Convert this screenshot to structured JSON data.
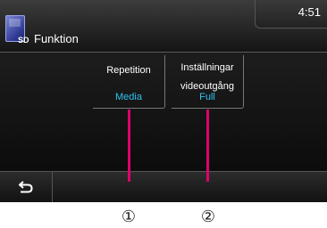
{
  "header": {
    "sd_label": "SD",
    "title": "Funktion",
    "clock": "4:51"
  },
  "items": [
    {
      "label_lines": [
        "Repetition"
      ],
      "value": "Media"
    },
    {
      "label_lines": [
        "Inställningar",
        "videoutgång"
      ],
      "value": "Full"
    }
  ],
  "callouts": [
    "①",
    "②"
  ],
  "colors": {
    "value_text": "#2ec3f2",
    "callout_line": "#e0006b"
  },
  "icons": {
    "source": "sd-card-icon",
    "back": "back-arrow-icon"
  }
}
